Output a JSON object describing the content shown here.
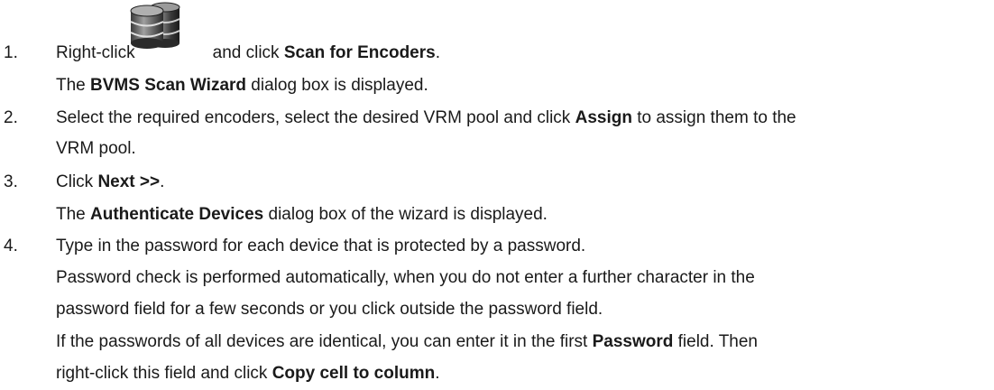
{
  "steps": [
    {
      "number": "1.",
      "line1_pre": "Right-click",
      "line1_mid": "and click",
      "line1_bold": "Scan for Encoders",
      "line1_end": ".",
      "line2_pre": "The",
      "line2_bold": "BVMS Scan Wizard",
      "line2_post": "dialog box is displayed.",
      "icon": "database-stack-icon"
    },
    {
      "number": "2.",
      "line1_pre": "Select the required encoders, select the desired VRM pool and click",
      "line1_bold": "Assign",
      "line1_post": "to assign them to the",
      "line2": "VRM pool."
    },
    {
      "number": "3.",
      "line1_pre": "Click",
      "line1_bold": "Next >>",
      "line1_end": ".",
      "line2_pre": "The",
      "line2_bold": "Authenticate Devices",
      "line2_post": "dialog box of the wizard is displayed."
    },
    {
      "number": "4.",
      "line1": "Type in the password for each device that is protected by a password.",
      "line2": "Password check is performed automatically, when you do not enter a further character in the",
      "line3": "password field for a few seconds or you click outside the password field.",
      "line4_pre": "If the passwords of all devices are identical, you can enter it in the first",
      "line4_bold": "Password",
      "line4_post": "field. Then",
      "line5_pre": "right-click this field and click",
      "line5_bold": "Copy cell to column",
      "line5_end": "."
    }
  ]
}
